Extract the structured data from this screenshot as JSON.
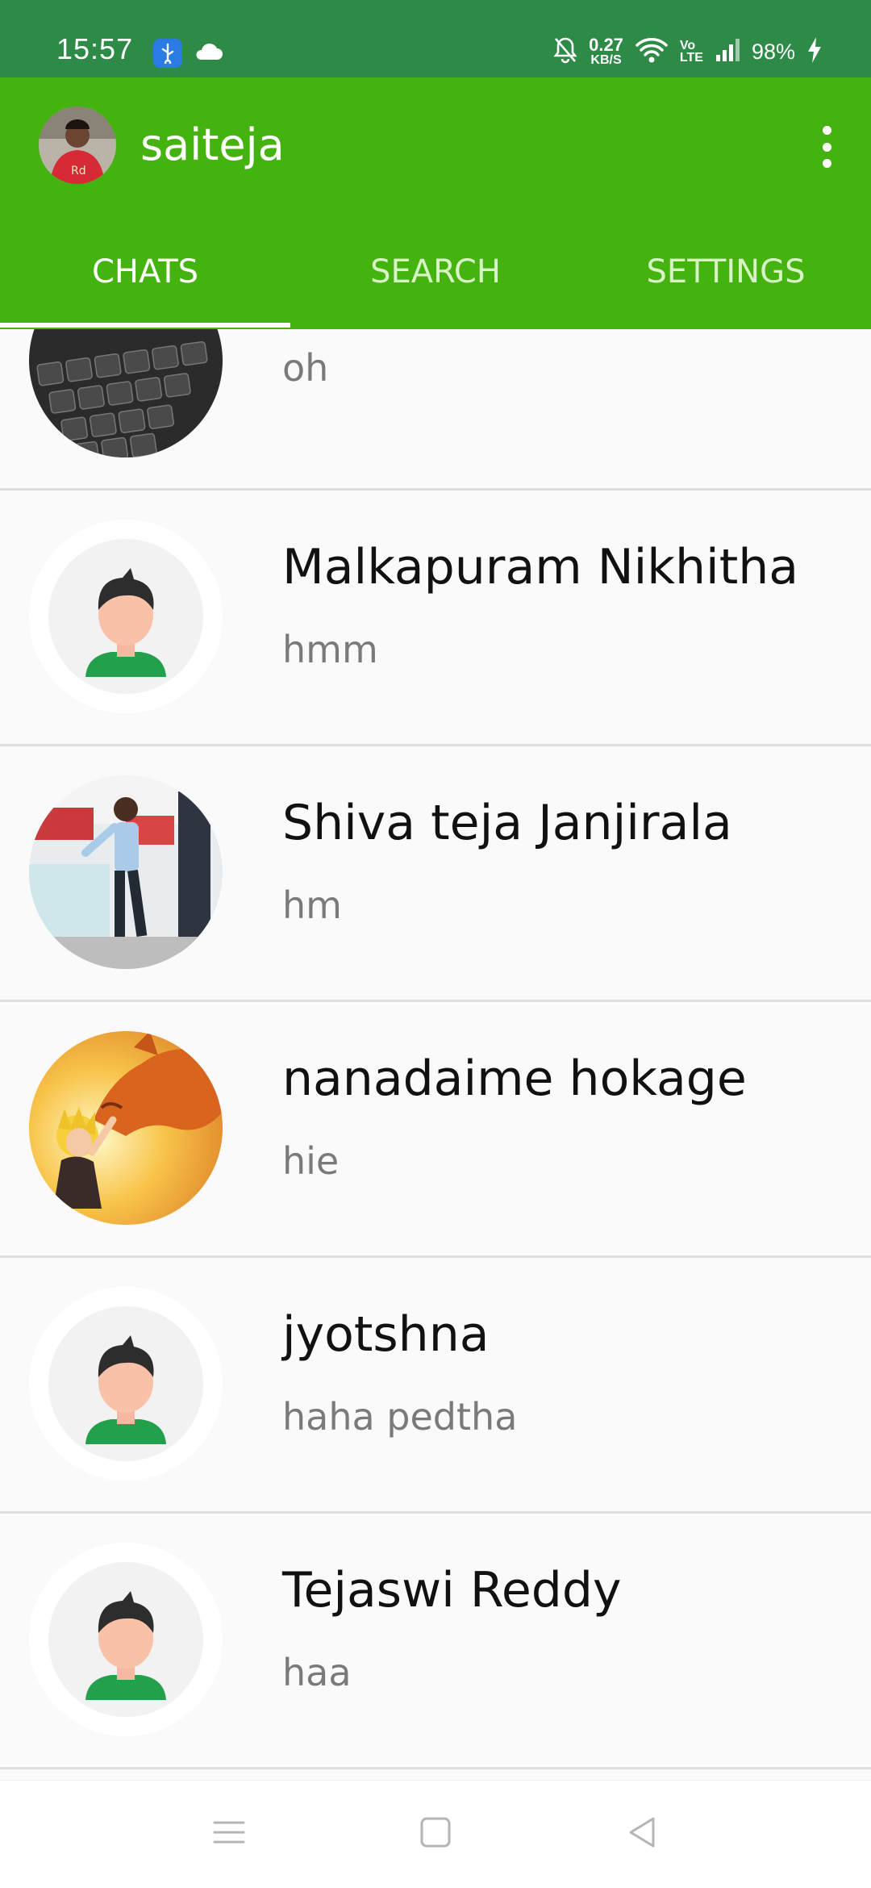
{
  "status_bar": {
    "time": "15:57",
    "net_speed_value": "0.27",
    "net_speed_unit": "KB/S",
    "volte_top": "Vo",
    "volte_bottom": "LTE",
    "battery": "98%"
  },
  "app_bar": {
    "title": "saiteja",
    "tabs": [
      {
        "label": "CHATS",
        "active": true
      },
      {
        "label": "SEARCH",
        "active": false
      },
      {
        "label": "SETTINGS",
        "active": false
      }
    ]
  },
  "chats": [
    {
      "name": "",
      "message": "oh",
      "avatar": "keyboard-photo"
    },
    {
      "name": "Malkapuram Nikhitha",
      "message": "hmm",
      "avatar": "default-avatar"
    },
    {
      "name": "Shiva teja Janjirala",
      "message": "hm",
      "avatar": "person-photo"
    },
    {
      "name": "nanadaime hokage",
      "message": "hie",
      "avatar": "anime-photo"
    },
    {
      "name": "jyotshna",
      "message": "haha pedtha",
      "avatar": "default-avatar"
    },
    {
      "name": "Tejaswi Reddy",
      "message": "haa",
      "avatar": "default-avatar"
    }
  ],
  "colors": {
    "status_bar": "#2e8b47",
    "app_bar": "#45b30f",
    "divider": "#dedede"
  }
}
